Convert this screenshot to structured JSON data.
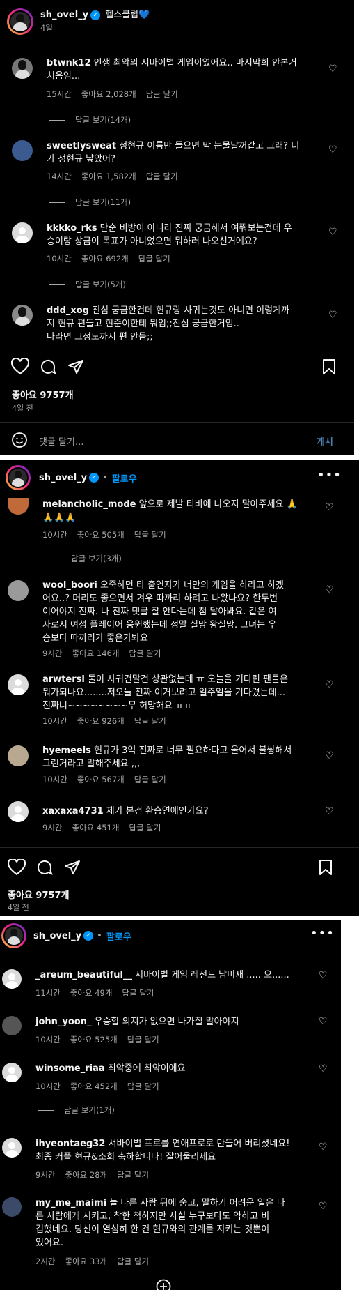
{
  "panel1": {
    "username": "sh_ovel_y",
    "caption": "헬스클럽",
    "caption_emoji": "💙",
    "time": "4일",
    "comments": [
      {
        "user": "btwnk12",
        "line1": "인생 최악의 서바이벌 게임이였어요.. 마지막회 안본거",
        "line2": "처음임...",
        "time": "15시간",
        "likes": "좋아요 2,028개",
        "reply": "답글 달기",
        "view_replies": "답글 보기(14개)"
      },
      {
        "user": "sweetlysweat",
        "line1": "정현규 이름만 들으면 막 눈물날꺼같고 그래? 너",
        "line2": "가 정현규 낳았어?",
        "time": "14시간",
        "likes": "좋아요 1,582개",
        "reply": "답글 달기",
        "view_replies": "답글 보기(11개)"
      },
      {
        "user": "kkkko_rks",
        "line1": "단순 비방이 아니라 진짜 궁금해서 여쭤보는건데 우",
        "line2": "승이랑 상금이 목표가 아니었으면 뭐하러 나오신거에요?",
        "time": "10시간",
        "likes": "좋아요 692개",
        "reply": "답글 달기",
        "view_replies": "답글 보기(5개)"
      },
      {
        "user": "ddd_xog",
        "line1": "진심 궁금한건데 현규랑 사귀는것도 아니면 이렇게까",
        "line2": "지 현규 편들고 현준이한테 뭐임;;진심 궁금한거임..",
        "line3": "나라면 그정도까지 편 안듬;;"
      }
    ],
    "likes_count": "좋아요 9757개",
    "date": "4일 전",
    "add_comment_placeholder": "댓글 달기...",
    "post_label": "게시"
  },
  "panel2": {
    "username": "sh_ovel_y",
    "follow": "팔로우",
    "comments": [
      {
        "user": "melancholic_mode",
        "line1": "앞으로 제발 티비에 나오지 말아주세요 🙏",
        "line2": "🙏🙏🙏",
        "time": "10시간",
        "likes": "좋아요 505개",
        "reply": "답글 달기",
        "view_replies": "답글 보기(3개)"
      },
      {
        "user": "wool_boori",
        "line1": "오죽하면 타 출연자가 너만의 게임을 하라고 하겠",
        "line2": "어요..? 머리도 좋으면서 겨우 따까리 하려고 나왔나요? 한두번",
        "line3": "이어야지 진짜. 나 진짜 댓글 잘 안다는데 첨 달아봐요. 같은 여",
        "line4": "자로서 여성 플레이어 응원했는데 정말 실망 왕실망. 그녀는 우",
        "line5": "승보다 따까리가 좋은가봐요",
        "time": "9시간",
        "likes": "좋아요 146개",
        "reply": "답글 달기"
      },
      {
        "user": "arwtersl",
        "line1": "둘이 사귀건말건 상관없는데 ㅠ 오늘을 기다린 팬들은",
        "line2": "뭐가되나요........저오늘 진짜 이거보려고 일주일을 기다렸는데...",
        "line3": "진짜너~~~~~~~~무 허망해요 ㅠㅠ",
        "time": "10시간",
        "likes": "좋아요 926개",
        "reply": "답글 달기"
      },
      {
        "user": "hyemeeis",
        "line1": "현규가 3억 진짜로 너무 필요하다고 울어서 불쌍해서",
        "line2": "그런거라고 말해주세요 ,,,",
        "time": "10시간",
        "likes": "좋아요 567개",
        "reply": "답글 달기"
      },
      {
        "user": "xaxaxa4731",
        "line1": "제가 본건 환승연애인가요?",
        "time": "9시간",
        "likes": "좋아요 451개",
        "reply": "답글 달기"
      }
    ],
    "likes_count": "좋아요 9757개",
    "date": "4일 전"
  },
  "panel3": {
    "username": "sh_ovel_y",
    "follow": "팔로우",
    "comments": [
      {
        "user": "_areum_beautiful__",
        "line1": "서바이벌 게임 레전드 남미새 ..... 으......",
        "time": "11시간",
        "likes": "좋아요 49개",
        "reply": "답글 달기"
      },
      {
        "user": "john_yoon_",
        "line1": "우승할 의지가 없으면 나가질 말아야지",
        "time": "10시간",
        "likes": "좋아요 525개",
        "reply": "답글 달기"
      },
      {
        "user": "winsome_riaa",
        "line1": "최악중에 최악이에요",
        "time": "10시간",
        "likes": "좋아요 452개",
        "reply": "답글 달기",
        "view_replies": "답글 보기(1개)"
      },
      {
        "user": "ihyeontaeg32",
        "line1": "서바이벌 프로를 연애프로로 만들어 버리셨네요!",
        "line2": "최종 커플 현규&소희 축하합니다! 잘어울리세요",
        "time": "9시간",
        "likes": "좋아요 28개",
        "reply": "답글 달기"
      },
      {
        "user": "my_me_maimi",
        "line1": "늘 다른 사람 뒤에 숨고, 말하기 어려운 일은 다",
        "line2": "른 사람에게 시키고, 착한 척하지만 사실 누구보다도 약하고 비",
        "line3": "겁했네요. 당신이 열심히 한 건 현규와의 관계를 지키는 것뿐이",
        "line4": "었어요.",
        "time": "2시간",
        "likes": "좋아요 33개",
        "reply": "답글 달기"
      }
    ]
  },
  "colors": {
    "background": "#000000",
    "text": "#f5f5f5",
    "muted": "#a8a8a8",
    "link": "#0095f6"
  },
  "icons": [
    "heart-icon",
    "comment-icon",
    "share-icon",
    "bookmark-icon",
    "emoji-icon",
    "more-icon",
    "add-circle-icon",
    "verified-badge-icon"
  ]
}
